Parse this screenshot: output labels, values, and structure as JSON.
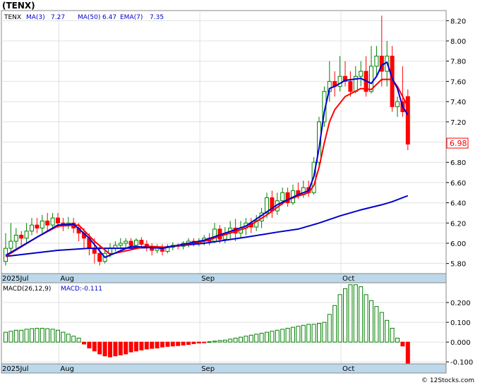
{
  "header": {
    "ticker": "(TENX)",
    "legend_symbol": "TENX",
    "ma3_label": "MA(3)",
    "ma3_value": "7.27",
    "ma50_label": "MA(50)",
    "ma50_value": "6.47",
    "ema7_label": "EMA(7)",
    "ema7_value": "7.35",
    "last_price": "6.98"
  },
  "macd_header": {
    "params": "MACD(26,12,9)",
    "value_label": "MACD:-0.111"
  },
  "watermark": "© 12Stocks.com",
  "colors": {
    "up": "#008000",
    "down": "#ff0000",
    "ma3": "#0000cc",
    "ma50": "#0000cc",
    "ema7": "#ff0000",
    "axis_band": "#bcd8ea",
    "grid": "#e0e0e0"
  },
  "chart_data": [
    {
      "type": "candlestick",
      "yticks": [
        "5.80",
        "6.00",
        "6.20",
        "6.40",
        "6.60",
        "6.80",
        "7.00",
        "7.20",
        "7.40",
        "7.60",
        "7.80",
        "8.00",
        "8.20"
      ],
      "ylim": [
        5.7,
        8.3
      ],
      "xlabels": [
        "2025Jul",
        "Aug",
        "Sep",
        "Oct"
      ],
      "candles": [
        [
          5.82,
          5.95,
          5.78,
          6.1
        ],
        [
          5.95,
          6.02,
          5.9,
          6.2
        ],
        [
          6.02,
          6.08,
          5.95,
          6.15
        ],
        [
          6.08,
          6.05,
          5.98,
          6.12
        ],
        [
          6.05,
          6.12,
          6.0,
          6.2
        ],
        [
          6.12,
          6.18,
          6.08,
          6.25
        ],
        [
          6.18,
          6.15,
          6.1,
          6.25
        ],
        [
          6.15,
          6.22,
          6.1,
          6.28
        ],
        [
          6.22,
          6.18,
          6.12,
          6.3
        ],
        [
          6.18,
          6.25,
          6.15,
          6.3
        ],
        [
          6.25,
          6.2,
          6.15,
          6.3
        ],
        [
          6.2,
          6.18,
          6.12,
          6.25
        ],
        [
          6.18,
          6.2,
          6.14,
          6.26
        ],
        [
          6.2,
          6.15,
          6.1,
          6.25
        ],
        [
          6.15,
          6.1,
          6.02,
          6.2
        ],
        [
          6.1,
          6.05,
          5.95,
          6.15
        ],
        [
          6.05,
          5.95,
          5.88,
          6.1
        ],
        [
          5.95,
          5.9,
          5.8,
          6.05
        ],
        [
          5.9,
          5.82,
          5.78,
          5.98
        ],
        [
          5.82,
          5.9,
          5.8,
          5.95
        ],
        [
          5.9,
          5.95,
          5.86,
          6.0
        ],
        [
          5.95,
          5.98,
          5.92,
          6.02
        ],
        [
          5.98,
          6.0,
          5.94,
          6.05
        ],
        [
          6.0,
          6.02,
          5.95,
          6.05
        ],
        [
          6.02,
          5.98,
          5.93,
          6.05
        ],
        [
          5.98,
          6.03,
          5.95,
          6.05
        ],
        [
          6.03,
          5.99,
          5.95,
          6.06
        ],
        [
          5.99,
          5.97,
          5.92,
          6.03
        ],
        [
          5.97,
          5.93,
          5.88,
          6.0
        ],
        [
          5.93,
          5.96,
          5.9,
          5.99
        ],
        [
          5.96,
          5.92,
          5.88,
          5.99
        ],
        [
          5.92,
          5.96,
          5.9,
          5.99
        ],
        [
          5.96,
          5.98,
          5.93,
          6.01
        ],
        [
          5.98,
          5.97,
          5.94,
          6.0
        ],
        [
          5.97,
          6.0,
          5.94,
          6.02
        ],
        [
          6.0,
          6.02,
          5.96,
          6.05
        ],
        [
          6.02,
          6.0,
          5.97,
          6.05
        ],
        [
          6.0,
          6.02,
          5.97,
          6.05
        ],
        [
          6.02,
          6.05,
          5.98,
          6.08
        ],
        [
          6.05,
          6.02,
          5.98,
          6.1
        ],
        [
          6.02,
          6.14,
          6.0,
          6.2
        ],
        [
          6.14,
          6.04,
          6.0,
          6.18
        ],
        [
          6.04,
          6.1,
          6.0,
          6.16
        ],
        [
          6.1,
          6.15,
          6.04,
          6.22
        ],
        [
          6.15,
          6.1,
          6.02,
          6.24
        ],
        [
          6.1,
          6.15,
          6.05,
          6.22
        ],
        [
          6.15,
          6.2,
          6.08,
          6.25
        ],
        [
          6.2,
          6.16,
          6.1,
          6.25
        ],
        [
          6.16,
          6.22,
          6.12,
          6.28
        ],
        [
          6.22,
          6.3,
          6.15,
          6.35
        ],
        [
          6.3,
          6.45,
          6.25,
          6.5
        ],
        [
          6.45,
          6.32,
          6.25,
          6.52
        ],
        [
          6.32,
          6.42,
          6.28,
          6.5
        ],
        [
          6.42,
          6.5,
          6.38,
          6.55
        ],
        [
          6.5,
          6.4,
          6.36,
          6.55
        ],
        [
          6.4,
          6.52,
          6.38,
          6.58
        ],
        [
          6.52,
          6.48,
          6.44,
          6.6
        ],
        [
          6.48,
          6.55,
          6.45,
          6.62
        ],
        [
          6.55,
          6.5,
          6.46,
          6.62
        ],
        [
          6.5,
          6.8,
          6.48,
          6.85
        ],
        [
          6.8,
          7.2,
          6.75,
          7.25
        ],
        [
          7.2,
          7.5,
          7.15,
          7.55
        ],
        [
          7.5,
          7.6,
          7.4,
          7.8
        ],
        [
          7.6,
          7.55,
          7.45,
          7.7
        ],
        [
          7.55,
          7.65,
          7.5,
          7.85
        ],
        [
          7.65,
          7.6,
          7.55,
          7.8
        ],
        [
          7.6,
          7.5,
          7.45,
          7.7
        ],
        [
          7.5,
          7.65,
          7.48,
          7.75
        ],
        [
          7.65,
          7.7,
          7.55,
          7.8
        ],
        [
          7.7,
          7.5,
          7.45,
          7.85
        ],
        [
          7.5,
          7.75,
          7.48,
          7.95
        ],
        [
          7.75,
          7.85,
          7.65,
          7.95
        ],
        [
          7.85,
          7.7,
          7.55,
          8.25
        ],
        [
          7.7,
          7.85,
          7.55,
          8.0
        ],
        [
          7.85,
          7.35,
          7.3,
          7.95
        ],
        [
          7.35,
          7.4,
          7.25,
          7.45
        ],
        [
          7.4,
          7.3,
          7.25,
          7.75
        ],
        [
          7.45,
          6.98,
          6.92,
          7.52
        ]
      ],
      "ma3_points": [
        [
          0,
          5.88
        ],
        [
          6,
          6.06
        ],
        [
          10,
          6.18
        ],
        [
          13,
          6.19
        ],
        [
          16,
          6.05
        ],
        [
          19,
          5.86
        ],
        [
          24,
          5.97
        ],
        [
          30,
          5.95
        ],
        [
          38,
          6.03
        ],
        [
          46,
          6.17
        ],
        [
          52,
          6.38
        ],
        [
          56,
          6.48
        ],
        [
          58,
          6.52
        ],
        [
          59,
          6.66
        ],
        [
          60,
          6.94
        ],
        [
          61,
          7.3
        ],
        [
          62,
          7.53
        ],
        [
          63,
          7.55
        ],
        [
          65,
          7.61
        ],
        [
          68,
          7.63
        ],
        [
          70,
          7.58
        ],
        [
          71,
          7.65
        ],
        [
          72,
          7.76
        ],
        [
          73,
          7.79
        ],
        [
          74,
          7.63
        ],
        [
          75,
          7.53
        ],
        [
          76,
          7.35
        ],
        [
          77,
          7.27
        ]
      ],
      "ema7_points": [
        [
          0,
          5.87
        ],
        [
          6,
          6.06
        ],
        [
          10,
          6.17
        ],
        [
          14,
          6.18
        ],
        [
          17,
          6.02
        ],
        [
          20,
          5.89
        ],
        [
          27,
          5.97
        ],
        [
          31,
          5.96
        ],
        [
          38,
          6.02
        ],
        [
          46,
          6.15
        ],
        [
          50,
          6.28
        ],
        [
          54,
          6.43
        ],
        [
          58,
          6.5
        ],
        [
          59,
          6.57
        ],
        [
          60,
          6.75
        ],
        [
          61,
          6.99
        ],
        [
          62,
          7.2
        ],
        [
          63,
          7.32
        ],
        [
          65,
          7.45
        ],
        [
          68,
          7.53
        ],
        [
          70,
          7.52
        ],
        [
          72,
          7.62
        ],
        [
          74,
          7.62
        ],
        [
          75,
          7.55
        ],
        [
          76,
          7.45
        ],
        [
          77,
          7.35
        ]
      ],
      "ma50_points": [
        [
          0,
          5.87
        ],
        [
          10,
          5.93
        ],
        [
          16,
          5.95
        ],
        [
          22,
          5.95
        ],
        [
          30,
          5.96
        ],
        [
          38,
          6.0
        ],
        [
          46,
          6.06
        ],
        [
          52,
          6.11
        ],
        [
          56,
          6.14
        ],
        [
          60,
          6.2
        ],
        [
          64,
          6.27
        ],
        [
          68,
          6.33
        ],
        [
          72,
          6.38
        ],
        [
          74,
          6.41
        ],
        [
          77,
          6.47
        ]
      ]
    },
    {
      "type": "bar",
      "title": "MACD(26,12,9)",
      "yticks": [
        "-0.100",
        "0.000",
        "0.100",
        "0.200"
      ],
      "ylim": [
        -0.11,
        0.3
      ],
      "values": [
        0.05,
        0.055,
        0.06,
        0.06,
        0.065,
        0.068,
        0.07,
        0.07,
        0.068,
        0.065,
        0.06,
        0.05,
        0.04,
        0.03,
        0.02,
        -0.01,
        -0.03,
        -0.045,
        -0.06,
        -0.07,
        -0.075,
        -0.07,
        -0.065,
        -0.06,
        -0.05,
        -0.045,
        -0.04,
        -0.035,
        -0.032,
        -0.03,
        -0.025,
        -0.022,
        -0.02,
        -0.018,
        -0.015,
        -0.012,
        -0.008,
        -0.005,
        -0.002,
        0.002,
        0.005,
        0.008,
        0.01,
        0.015,
        0.02,
        0.025,
        0.03,
        0.035,
        0.04,
        0.045,
        0.05,
        0.055,
        0.06,
        0.065,
        0.07,
        0.075,
        0.08,
        0.085,
        0.09,
        0.09,
        0.095,
        0.1,
        0.14,
        0.185,
        0.24,
        0.27,
        0.29,
        0.29,
        0.28,
        0.24,
        0.21,
        0.18,
        0.15,
        0.11,
        0.07,
        0.02,
        -0.02,
        -0.111
      ]
    }
  ]
}
